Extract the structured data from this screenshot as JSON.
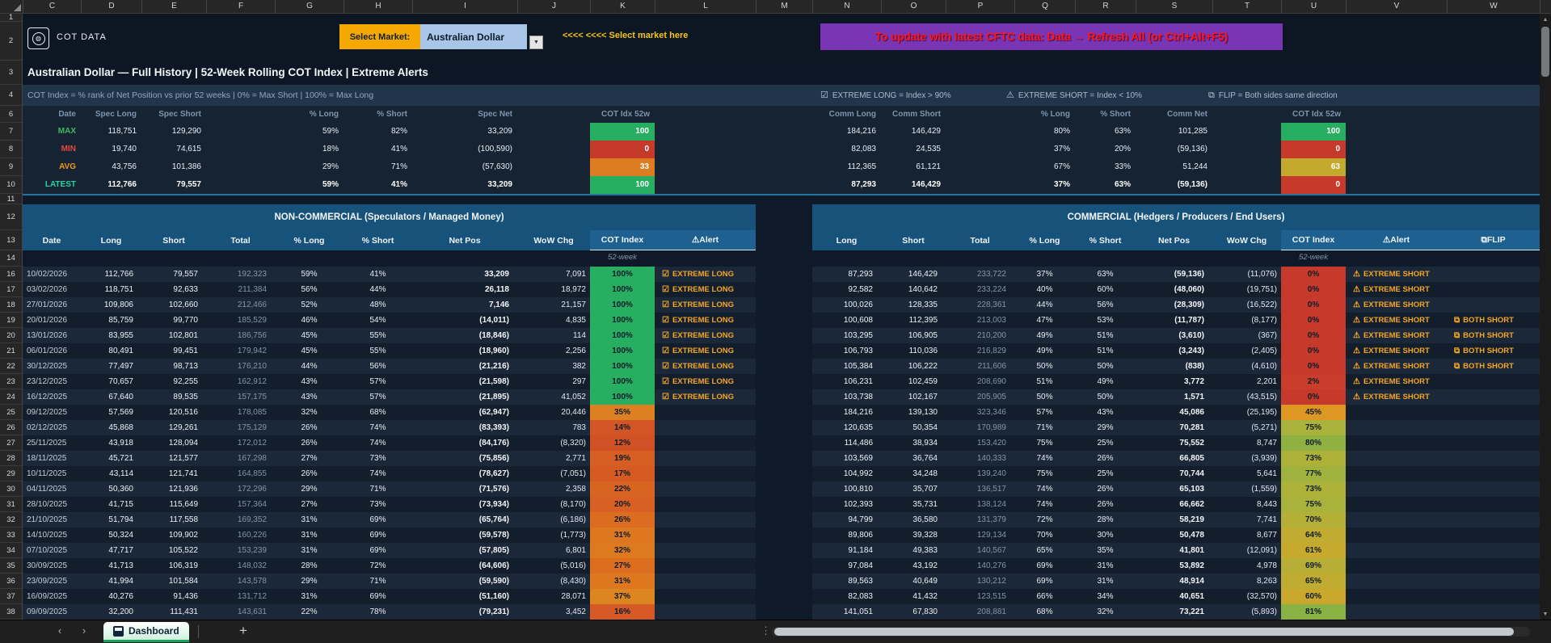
{
  "sheet": {
    "columns": [
      "C",
      "D",
      "E",
      "F",
      "G",
      "H",
      "I",
      "J",
      "K",
      "L",
      "M",
      "N",
      "O",
      "P",
      "Q",
      "R",
      "S",
      "T",
      "U",
      "V",
      "W"
    ],
    "rows": [
      "1",
      "2",
      "3",
      "4",
      "6",
      "7",
      "8",
      "9",
      "10",
      "11",
      "12",
      "13",
      "14",
      "16",
      "17",
      "18",
      "19",
      "20",
      "21",
      "22",
      "23",
      "24",
      "25",
      "26",
      "27",
      "28",
      "29",
      "30",
      "31",
      "32",
      "33",
      "34",
      "35",
      "36",
      "37",
      "38"
    ]
  },
  "header": {
    "logo_text": "COT DATA",
    "select_market_label": "Select Market:",
    "market_value": "Australian Dollar",
    "dropdown_icon": "▼",
    "hint": "<<<< <<<< Select market here",
    "banner": "To update with latest CFTC data: Data → Refresh All (or Ctrl+Alt+F5)"
  },
  "title": "Australian Dollar  —  Full History  |  52-Week Rolling COT Index  |  Extreme Alerts",
  "subtitle": "COT Index = % rank of Net Position vs prior 52 weeks  |  0% = Max Short  |  100% = Max Long",
  "legend": {
    "extreme_long": {
      "icon": "☑",
      "text": "EXTREME LONG = Index > 90%"
    },
    "extreme_short": {
      "icon": "⚠",
      "text": "EXTREME SHORT = Index < 10%"
    },
    "flip": {
      "icon": "⧉",
      "text": "FLIP = Both sides same direction"
    }
  },
  "summary": {
    "left_headers": [
      "Date",
      "Spec Long",
      "Spec Short",
      "% Long",
      "% Short",
      "Spec Net",
      "COT Idx 52w"
    ],
    "right_headers": [
      "Comm Long",
      "Comm Short",
      "% Long",
      "% Short",
      "Comm Net",
      "COT Idx 52w"
    ],
    "rows": [
      {
        "label": "MAX",
        "color": "#3dbb5a",
        "bold": false,
        "spec": [
          "118,751",
          "129,290",
          "59%",
          "82%",
          "33,209"
        ],
        "spec_idx": 100,
        "comm": [
          "184,216",
          "146,429",
          "80%",
          "63%",
          "101,285"
        ],
        "comm_idx": 100
      },
      {
        "label": "MIN",
        "color": "#e8483f",
        "bold": false,
        "spec": [
          "19,740",
          "74,615",
          "18%",
          "41%",
          "(100,590)"
        ],
        "spec_idx": 0,
        "comm": [
          "82,083",
          "24,535",
          "37%",
          "20%",
          "(59,136)"
        ],
        "comm_idx": 0
      },
      {
        "label": "AVG",
        "color": "#f39c12",
        "bold": false,
        "spec": [
          "43,756",
          "101,386",
          "29%",
          "71%",
          "(57,630)"
        ],
        "spec_idx": 33,
        "comm": [
          "112,365",
          "61,121",
          "67%",
          "33%",
          "51,244"
        ],
        "comm_idx": 63
      },
      {
        "label": "LATEST",
        "color": "#27d3a2",
        "bold": true,
        "spec": [
          "112,766",
          "79,557",
          "59%",
          "41%",
          "33,209"
        ],
        "spec_idx": 100,
        "comm": [
          "87,293",
          "146,429",
          "37%",
          "63%",
          "(59,136)"
        ],
        "comm_idx": 0
      }
    ]
  },
  "tables": {
    "noncommercial": {
      "title": "NON-COMMERCIAL  (Speculators / Managed Money)",
      "headers": [
        "Date",
        "Long",
        "Short",
        "Total",
        "% Long",
        "% Short",
        "Net Pos",
        "WoW Chg",
        "COT Index"
      ],
      "alert_header": "Alert",
      "alert_header_icon": "⚠",
      "subnote": "52-week",
      "rows": [
        [
          "10/02/2026",
          "112,766",
          "79,557",
          "192,323",
          "59%",
          "41%",
          "33,209",
          "7,091",
          100,
          "EXTREME LONG"
        ],
        [
          "03/02/2026",
          "118,751",
          "92,633",
          "211,384",
          "56%",
          "44%",
          "26,118",
          "18,972",
          100,
          "EXTREME LONG"
        ],
        [
          "27/01/2026",
          "109,806",
          "102,660",
          "212,466",
          "52%",
          "48%",
          "7,146",
          "21,157",
          100,
          "EXTREME LONG"
        ],
        [
          "20/01/2026",
          "85,759",
          "99,770",
          "185,529",
          "46%",
          "54%",
          "(14,011)",
          "4,835",
          100,
          "EXTREME LONG"
        ],
        [
          "13/01/2026",
          "83,955",
          "102,801",
          "186,756",
          "45%",
          "55%",
          "(18,846)",
          "114",
          100,
          "EXTREME LONG"
        ],
        [
          "06/01/2026",
          "80,491",
          "99,451",
          "179,942",
          "45%",
          "55%",
          "(18,960)",
          "2,256",
          100,
          "EXTREME LONG"
        ],
        [
          "30/12/2025",
          "77,497",
          "98,713",
          "176,210",
          "44%",
          "56%",
          "(21,216)",
          "382",
          100,
          "EXTREME LONG"
        ],
        [
          "23/12/2025",
          "70,657",
          "92,255",
          "162,912",
          "43%",
          "57%",
          "(21,598)",
          "297",
          100,
          "EXTREME LONG"
        ],
        [
          "16/12/2025",
          "67,640",
          "89,535",
          "157,175",
          "43%",
          "57%",
          "(21,895)",
          "41,052",
          100,
          "EXTREME LONG"
        ],
        [
          "09/12/2025",
          "57,569",
          "120,516",
          "178,085",
          "32%",
          "68%",
          "(62,947)",
          "20,446",
          35,
          ""
        ],
        [
          "02/12/2025",
          "45,868",
          "129,261",
          "175,129",
          "26%",
          "74%",
          "(83,393)",
          "783",
          14,
          ""
        ],
        [
          "25/11/2025",
          "43,918",
          "128,094",
          "172,012",
          "26%",
          "74%",
          "(84,176)",
          "(8,320)",
          12,
          ""
        ],
        [
          "18/11/2025",
          "45,721",
          "121,577",
          "167,298",
          "27%",
          "73%",
          "(75,856)",
          "2,771",
          19,
          ""
        ],
        [
          "10/11/2025",
          "43,114",
          "121,741",
          "164,855",
          "26%",
          "74%",
          "(78,627)",
          "(7,051)",
          17,
          ""
        ],
        [
          "04/11/2025",
          "50,360",
          "121,936",
          "172,296",
          "29%",
          "71%",
          "(71,576)",
          "2,358",
          22,
          ""
        ],
        [
          "28/10/2025",
          "41,715",
          "115,649",
          "157,364",
          "27%",
          "73%",
          "(73,934)",
          "(8,170)",
          20,
          ""
        ],
        [
          "21/10/2025",
          "51,794",
          "117,558",
          "169,352",
          "31%",
          "69%",
          "(65,764)",
          "(6,186)",
          26,
          ""
        ],
        [
          "14/10/2025",
          "50,324",
          "109,902",
          "160,226",
          "31%",
          "69%",
          "(59,578)",
          "(1,773)",
          31,
          ""
        ],
        [
          "07/10/2025",
          "47,717",
          "105,522",
          "153,239",
          "31%",
          "69%",
          "(57,805)",
          "6,801",
          32,
          ""
        ],
        [
          "30/09/2025",
          "41,713",
          "106,319",
          "148,032",
          "28%",
          "72%",
          "(64,606)",
          "(5,016)",
          27,
          ""
        ],
        [
          "23/09/2025",
          "41,994",
          "101,584",
          "143,578",
          "29%",
          "71%",
          "(59,590)",
          "(8,430)",
          31,
          ""
        ],
        [
          "16/09/2025",
          "40,276",
          "91,436",
          "131,712",
          "31%",
          "69%",
          "(51,160)",
          "28,071",
          37,
          ""
        ],
        [
          "09/09/2025",
          "32,200",
          "111,431",
          "143,631",
          "22%",
          "78%",
          "(79,231)",
          "3,452",
          16,
          ""
        ]
      ]
    },
    "commercial": {
      "title": "COMMERCIAL  (Hedgers / Producers / End Users)",
      "headers": [
        "Long",
        "Short",
        "Total",
        "% Long",
        "% Short",
        "Net Pos",
        "WoW Chg",
        "COT Index"
      ],
      "alert_header": "Alert",
      "alert_header_icon": "⚠",
      "flip_header": "FLIP",
      "flip_header_icon": "⧉",
      "subnote": "52-week",
      "rows": [
        [
          "87,293",
          "146,429",
          "233,722",
          "37%",
          "63%",
          "(59,136)",
          "(11,076)",
          0,
          "EXTREME SHORT",
          ""
        ],
        [
          "92,582",
          "140,642",
          "233,224",
          "40%",
          "60%",
          "(48,060)",
          "(19,751)",
          0,
          "EXTREME SHORT",
          ""
        ],
        [
          "100,026",
          "128,335",
          "228,361",
          "44%",
          "56%",
          "(28,309)",
          "(16,522)",
          0,
          "EXTREME SHORT",
          ""
        ],
        [
          "100,608",
          "112,395",
          "213,003",
          "47%",
          "53%",
          "(11,787)",
          "(8,177)",
          0,
          "EXTREME SHORT",
          "BOTH SHORT"
        ],
        [
          "103,295",
          "106,905",
          "210,200",
          "49%",
          "51%",
          "(3,610)",
          "(367)",
          0,
          "EXTREME SHORT",
          "BOTH SHORT"
        ],
        [
          "106,793",
          "110,036",
          "216,829",
          "49%",
          "51%",
          "(3,243)",
          "(2,405)",
          0,
          "EXTREME SHORT",
          "BOTH SHORT"
        ],
        [
          "105,384",
          "106,222",
          "211,606",
          "50%",
          "50%",
          "(838)",
          "(4,610)",
          0,
          "EXTREME SHORT",
          "BOTH SHORT"
        ],
        [
          "106,231",
          "102,459",
          "208,690",
          "51%",
          "49%",
          "3,772",
          "2,201",
          2,
          "EXTREME SHORT",
          ""
        ],
        [
          "103,738",
          "102,167",
          "205,905",
          "50%",
          "50%",
          "1,571",
          "(43,515)",
          0,
          "EXTREME SHORT",
          ""
        ],
        [
          "184,216",
          "139,130",
          "323,346",
          "57%",
          "43%",
          "45,086",
          "(25,195)",
          45,
          "",
          ""
        ],
        [
          "120,635",
          "50,354",
          "170,989",
          "71%",
          "29%",
          "70,281",
          "(5,271)",
          75,
          "",
          ""
        ],
        [
          "114,486",
          "38,934",
          "153,420",
          "75%",
          "25%",
          "75,552",
          "8,747",
          80,
          "",
          ""
        ],
        [
          "103,569",
          "36,764",
          "140,333",
          "74%",
          "26%",
          "66,805",
          "(3,939)",
          73,
          "",
          ""
        ],
        [
          "104,992",
          "34,248",
          "139,240",
          "75%",
          "25%",
          "70,744",
          "5,641",
          77,
          "",
          ""
        ],
        [
          "100,810",
          "35,707",
          "136,517",
          "74%",
          "26%",
          "65,103",
          "(1,559)",
          73,
          "",
          ""
        ],
        [
          "102,393",
          "35,731",
          "138,124",
          "74%",
          "26%",
          "66,662",
          "8,443",
          75,
          "",
          ""
        ],
        [
          "94,799",
          "36,580",
          "131,379",
          "72%",
          "28%",
          "58,219",
          "7,741",
          70,
          "",
          ""
        ],
        [
          "89,806",
          "39,328",
          "129,134",
          "70%",
          "30%",
          "50,478",
          "8,677",
          64,
          "",
          ""
        ],
        [
          "91,184",
          "49,383",
          "140,567",
          "65%",
          "35%",
          "41,801",
          "(12,091)",
          61,
          "",
          ""
        ],
        [
          "97,084",
          "43,192",
          "140,276",
          "69%",
          "31%",
          "53,892",
          "4,978",
          69,
          "",
          ""
        ],
        [
          "89,563",
          "40,649",
          "130,212",
          "69%",
          "31%",
          "48,914",
          "8,263",
          65,
          "",
          ""
        ],
        [
          "82,083",
          "41,432",
          "123,515",
          "66%",
          "34%",
          "40,651",
          "(32,570)",
          60,
          "",
          ""
        ],
        [
          "141,051",
          "67,830",
          "208,881",
          "68%",
          "32%",
          "73,221",
          "(5,893)",
          81,
          "",
          ""
        ]
      ]
    }
  },
  "alert_icons": {
    "EXTREME LONG": "☑",
    "EXTREME SHORT": "⚠",
    "BOTH SHORT": "⧉"
  },
  "footer": {
    "tab_label": "Dashboard"
  },
  "colors": {
    "select_label_bg": "#f5a800",
    "market_cell_bg": "#a9c6e8",
    "banner_bg": "#7a35b5",
    "banner_text": "#ff1616",
    "alert_gold": "#f5a623",
    "section_blue": "#17527a",
    "header_highlight": "#1e6191",
    "tab_underline": "#17a35c",
    "idx_scale": {
      "0": "#c63a2c",
      "25": "#dc6a1f",
      "50": "#dfa224",
      "75": "#a9b23a",
      "100": "#27ae60"
    }
  }
}
